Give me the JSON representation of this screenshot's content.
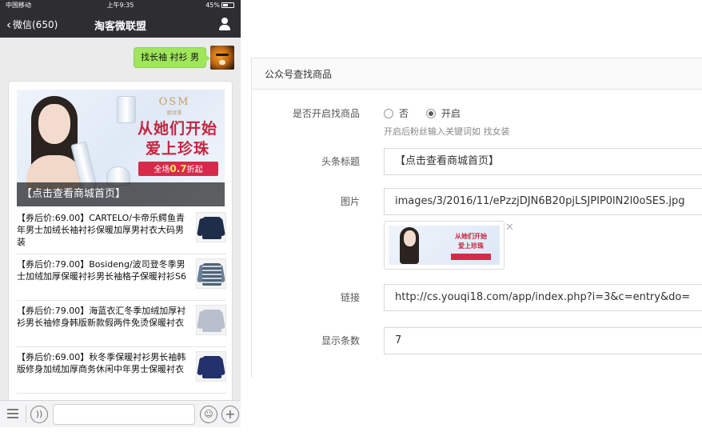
{
  "phone": {
    "status": {
      "carrier": "中国移动",
      "time": "上午9:35",
      "battery": "45%"
    },
    "nav": {
      "back_label": "微信(650)",
      "title": "淘客微联盟"
    },
    "message_out": "找长袖 衬衫 男",
    "banner": {
      "brand": "OSM",
      "brand_sub": "欧诗漫",
      "headline_1": "从她们开始",
      "headline_2": "爱上珍珠",
      "promo_prefix": "全场",
      "promo_value": "0.7",
      "promo_suffix": "折起",
      "caption": "【点击查看商城首页】"
    },
    "items": [
      {
        "text": "【券后价:69.00】CARTELO/卡帝乐鳄鱼青年男士加绒长袖衬衫保暖加厚男衬衣大码男装",
        "thumb_color": "#1d2d4a"
      },
      {
        "text": "【券后价:79.00】Bosideng/波司登冬季男士加绒加厚保暖衬衫男长袖格子保暖衬衫S6",
        "thumb_color": "#6a7f96"
      },
      {
        "text": "【券后价:79.00】海蓝衣汇冬季加绒加厚衬衫男长袖修身韩版新款假两件免烫保暖衬衣",
        "thumb_color": "#b7c0cc"
      },
      {
        "text": "【券后价:69.00】秋冬季保暖衬衫男长袖韩版修身加绒加厚商务休闲中年男士保暖衬衣",
        "thumb_color": "#22306b"
      }
    ]
  },
  "form": {
    "title": "公众号查找商品",
    "enable_label": "是否开启找商品",
    "options": [
      {
        "label": "否",
        "selected": false
      },
      {
        "label": "开启",
        "selected": true
      }
    ],
    "help": "开启后粉丝输入关键词如 找女装",
    "headline_label": "头条标题",
    "headline_value": "【点击查看商城首页】",
    "image_label": "图片",
    "image_value": "images/3/2016/11/ePzzjDJN6B20pjLSJPIP0lN2l0oSES.jpg",
    "image_preview_headline_1": "从她们开始",
    "image_preview_headline_2": "爱上珍珠",
    "link_label": "链接",
    "link_value": "http://cs.youqi18.com/app/index.php?i=3&c=entry&do=",
    "count_label": "显示条数",
    "count_value": "7"
  }
}
